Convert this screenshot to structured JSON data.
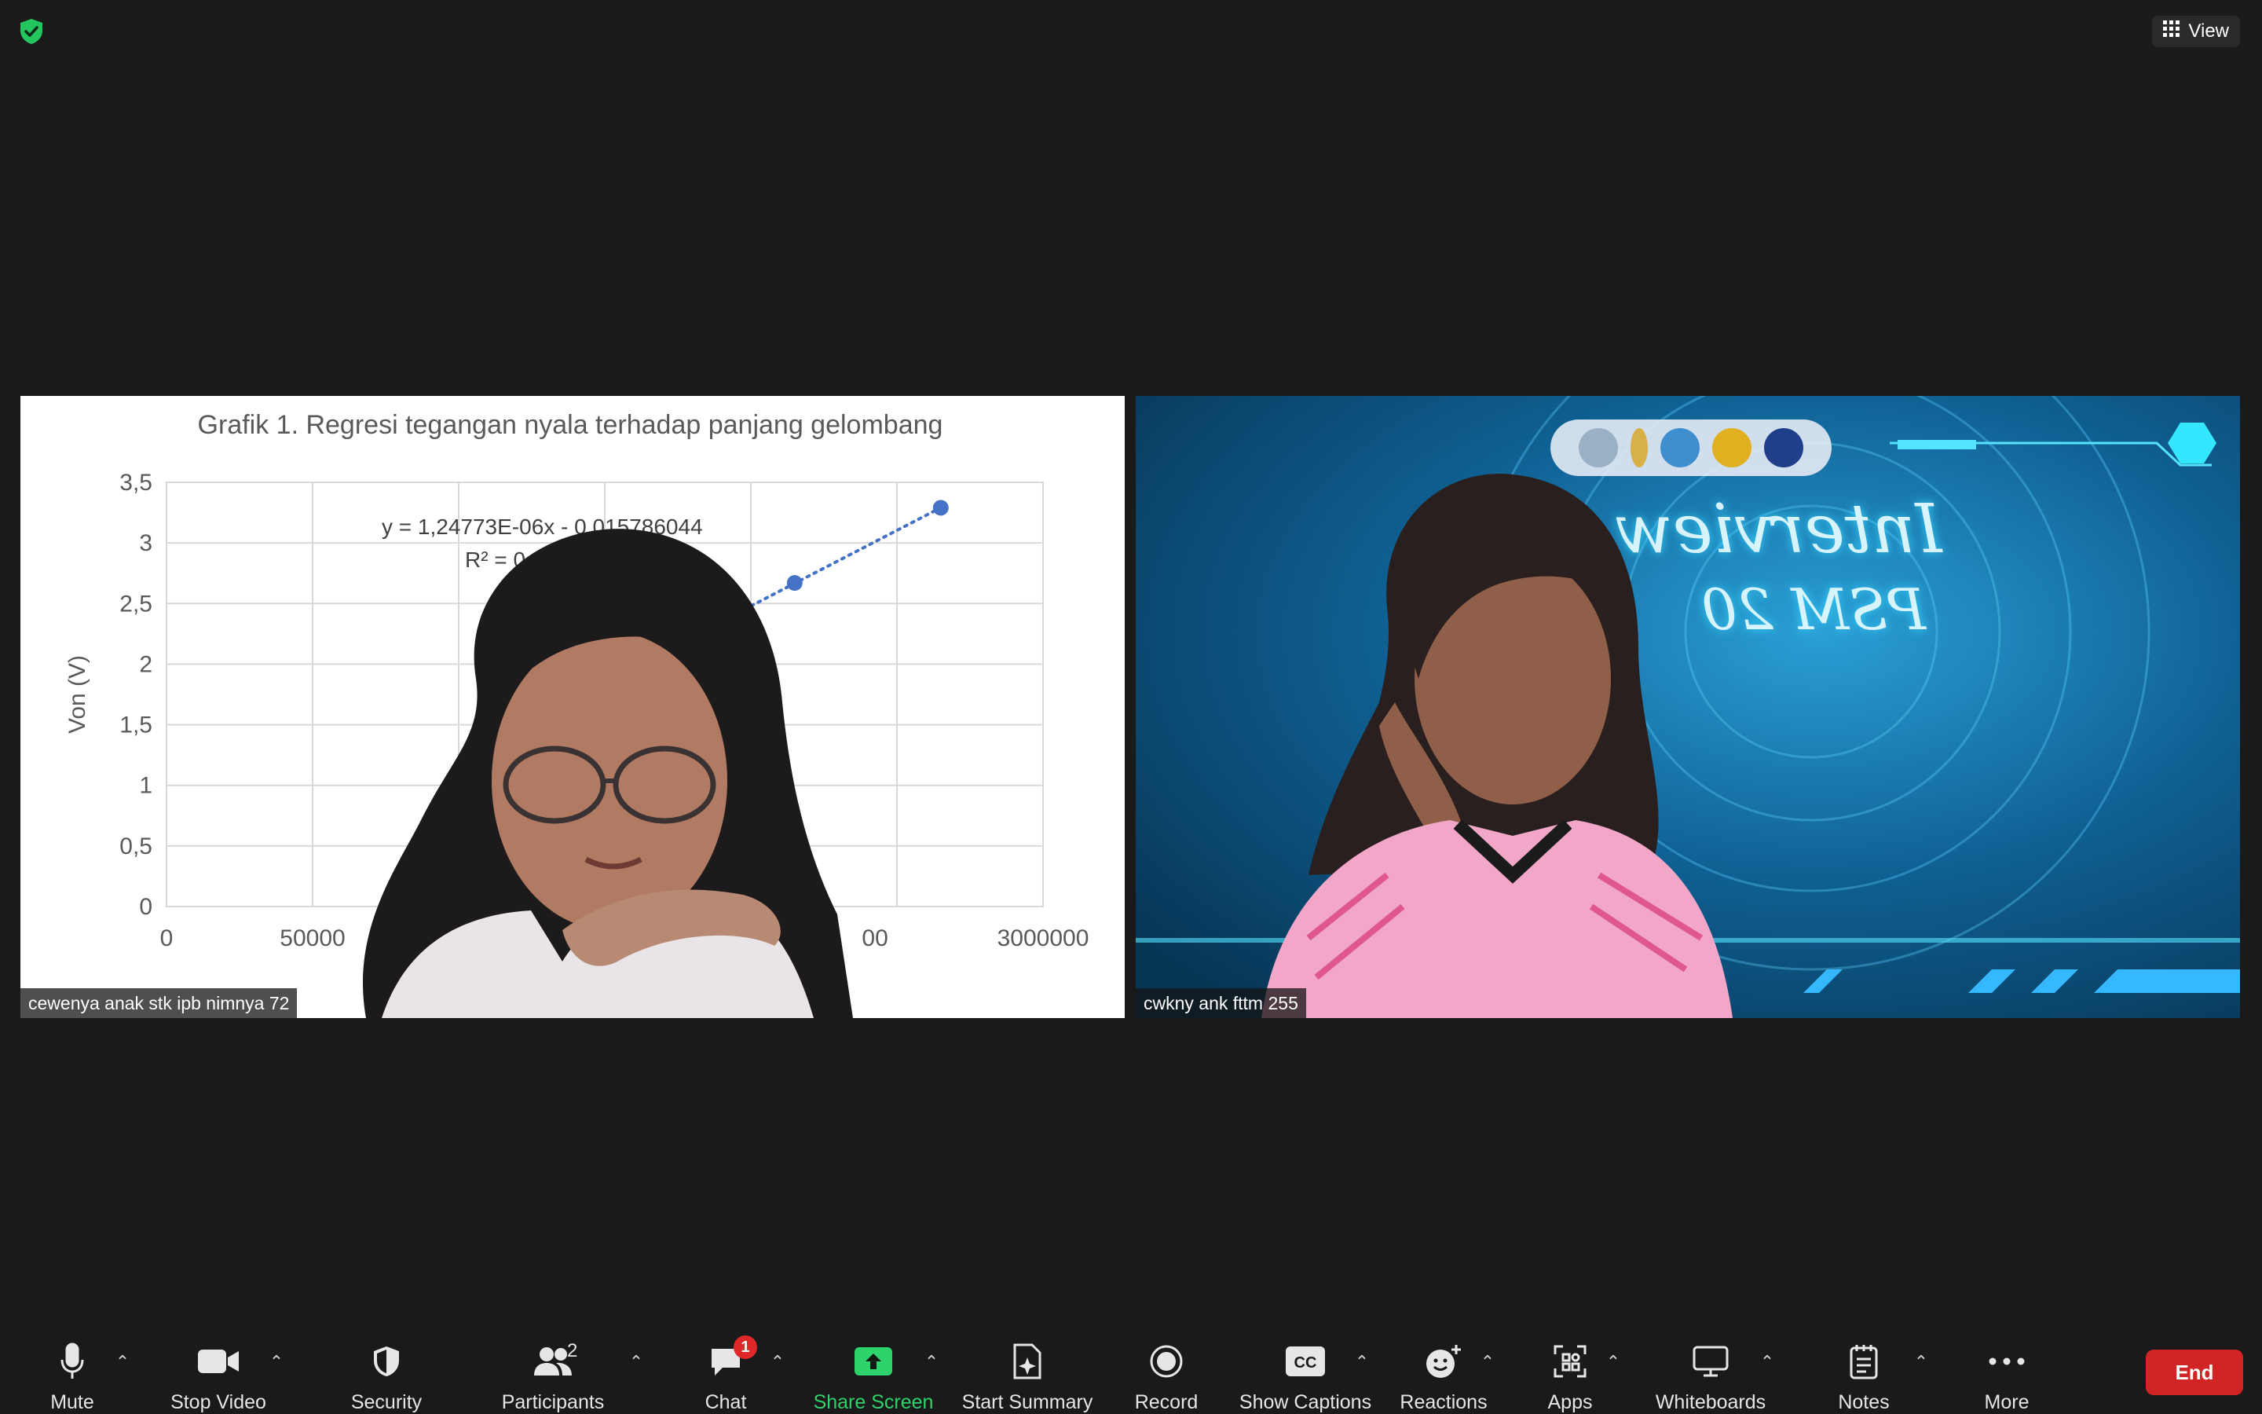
{
  "top": {
    "view_label": "View"
  },
  "tiles": {
    "left": {
      "name": "cewenya anak stk ipb nimnya 72"
    },
    "right": {
      "name": "cwkny ank fttm 255",
      "banner_line1": "Interview",
      "banner_line2": "PSM 20"
    }
  },
  "chart_data": {
    "type": "scatter",
    "title": "Grafik 1.  Regresi tegangan nyala terhadap panjang gelombang",
    "ylabel": "Von (V)",
    "xlabel": "",
    "yticks": [
      "0",
      "0,5",
      "1",
      "1,5",
      "2",
      "2,5",
      "3",
      "3,5"
    ],
    "xticks": [
      "0",
      "500000",
      "3000000"
    ],
    "visible_xticks_text": [
      "0",
      "50000",
      "00",
      "3000000"
    ],
    "ylim": [
      0,
      3.5
    ],
    "xlim": [
      0,
      3000000
    ],
    "equation": "y = 1,24773E-06x - 0,015786044",
    "r_squared_label": "R² = 0,",
    "points": [
      {
        "x": 2150000,
        "y": 2.67
      },
      {
        "x": 2650000,
        "y": 3.29
      }
    ],
    "trendline": "dotted linear",
    "grid": true,
    "colors": {
      "points": "#4472c4",
      "grid": "#d9d9d9"
    }
  },
  "toolbar": {
    "mute": "Mute",
    "stop_video": "Stop Video",
    "security": "Security",
    "participants": "Participants",
    "participants_count": "2",
    "chat": "Chat",
    "chat_badge": "1",
    "share_screen": "Share Screen",
    "start_summary": "Start Summary",
    "record": "Record",
    "show_captions": "Show Captions",
    "reactions": "Reactions",
    "apps": "Apps",
    "whiteboards": "Whiteboards",
    "notes": "Notes",
    "more": "More",
    "end": "End",
    "cc_icon_text": "CC"
  },
  "colors": {
    "background": "#1a1a1a",
    "share_green": "#2ed36b",
    "end_red": "#d12424",
    "security_green": "#22c55e"
  }
}
